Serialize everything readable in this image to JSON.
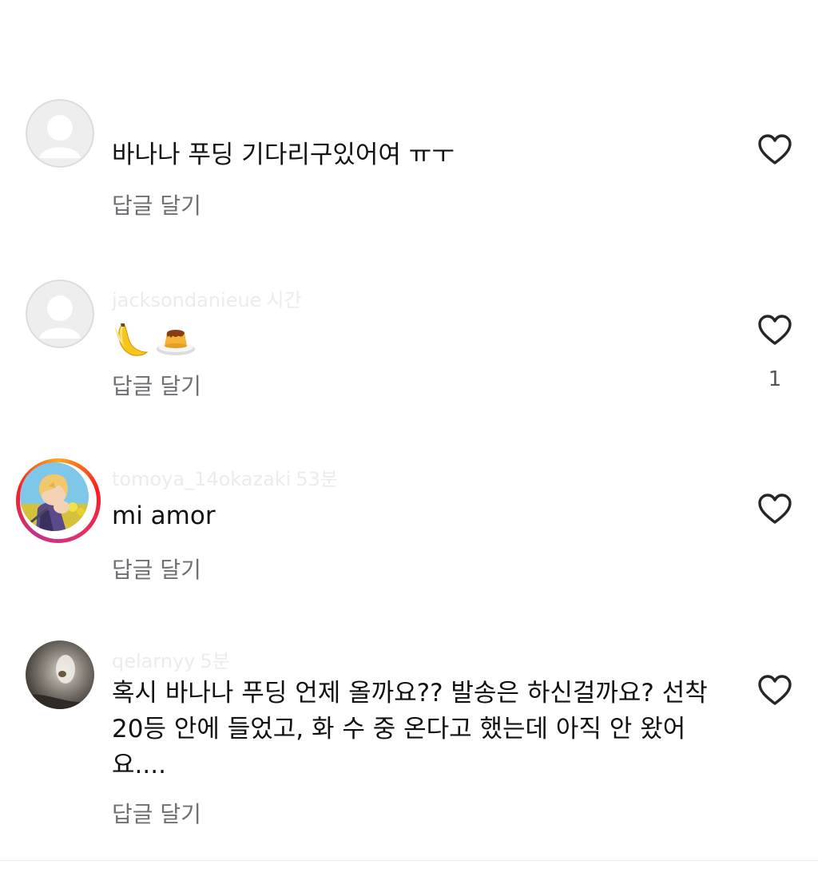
{
  "comments": [
    {
      "username": "",
      "time": "",
      "text": "바나나 푸딩 기다리구있어여 ㅠㅜ",
      "reply_label": "답글 달기",
      "likes": "",
      "avatar": "default-avatar"
    },
    {
      "username": "jacksondanieue",
      "time": "시간",
      "text": "",
      "emojis": [
        "banana-emoji",
        "pudding-emoji"
      ],
      "reply_label": "답글 달기",
      "likes": "1",
      "avatar": "default-avatar"
    },
    {
      "username": "tomoya_14okazaki",
      "time": "53분",
      "text": "mi amor",
      "reply_label": "답글 달기",
      "likes": "",
      "avatar": "anime-avatar-with-story-ring"
    },
    {
      "username": "qelarnyy",
      "time": "5분",
      "text": "혹시 바나나 푸딩 언제 올까요?? 발송은 하신걸까요? 선착 20등 안에 들었고, 화 수 중 온다고 했는데 아직 안 왔어요....",
      "reply_label": "답글 달기",
      "likes": "",
      "avatar": "photo-avatar"
    }
  ],
  "icons": {
    "like": "heart-outline-icon"
  },
  "colors": {
    "text": "#111111",
    "secondary": "#6f6f74",
    "faded_username": "#ececec",
    "story_ring_start": "#f9a825",
    "story_ring_end": "#c13584"
  }
}
